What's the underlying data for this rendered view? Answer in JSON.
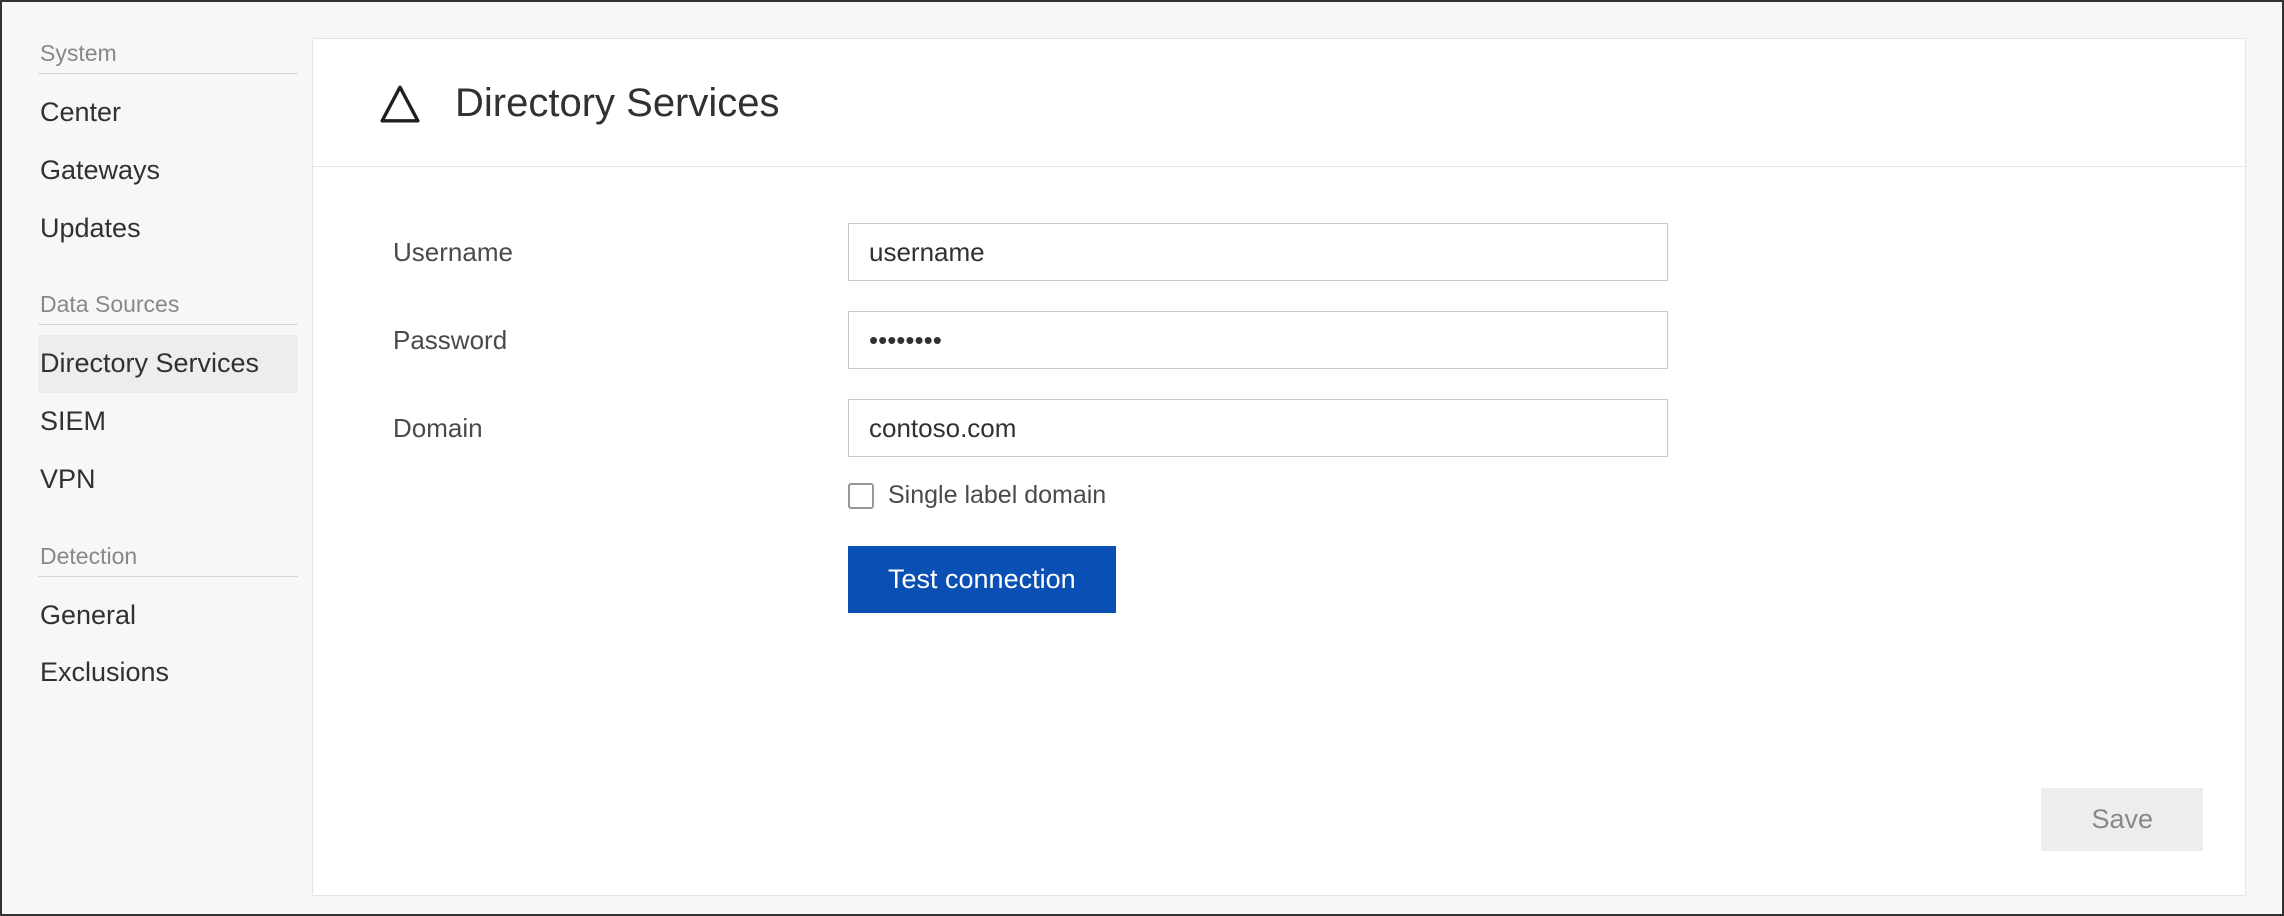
{
  "sidebar": {
    "sections": [
      {
        "label": "System",
        "items": [
          {
            "label": "Center",
            "active": false
          },
          {
            "label": "Gateways",
            "active": false
          },
          {
            "label": "Updates",
            "active": false
          }
        ]
      },
      {
        "label": "Data Sources",
        "items": [
          {
            "label": "Directory Services",
            "active": true
          },
          {
            "label": "SIEM",
            "active": false
          },
          {
            "label": "VPN",
            "active": false
          }
        ]
      },
      {
        "label": "Detection",
        "items": [
          {
            "label": "General",
            "active": false
          },
          {
            "label": "Exclusions",
            "active": false
          }
        ]
      }
    ]
  },
  "page": {
    "title": "Directory Services"
  },
  "form": {
    "username": {
      "label": "Username",
      "value": "username"
    },
    "password": {
      "label": "Password",
      "value": "••••••••"
    },
    "domain": {
      "label": "Domain",
      "value": "contoso.com"
    },
    "single_label_domain": {
      "label": "Single label domain",
      "checked": false
    },
    "test_button": "Test connection",
    "save_button": "Save"
  },
  "colors": {
    "primary": "#0a4fb3",
    "page_bg": "#f6f7f8",
    "panel_bg": "#ffffff",
    "border": "#e5e5e5",
    "muted": "#8a8886"
  }
}
